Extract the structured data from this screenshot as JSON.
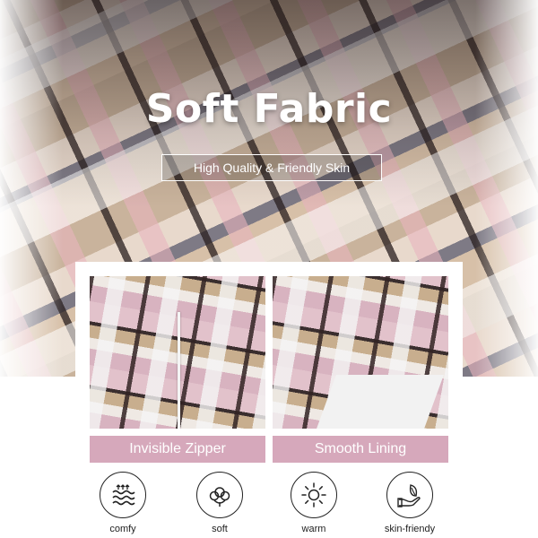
{
  "hero": {
    "title": "Soft Fabric",
    "subtitle": "High Quality & Friendly Skin"
  },
  "details": [
    {
      "label": "Invisible Zipper"
    },
    {
      "label": "Smooth Lining"
    }
  ],
  "features": [
    {
      "label": "comfy",
      "icon": "comfy-waves-icon"
    },
    {
      "label": "soft",
      "icon": "cotton-icon"
    },
    {
      "label": "warm",
      "icon": "sun-icon"
    },
    {
      "label": "skin-friendy",
      "icon": "hand-leaf-icon"
    }
  ],
  "colors": {
    "label_bar": "#d6a8bb",
    "icon_stroke": "#222222"
  }
}
